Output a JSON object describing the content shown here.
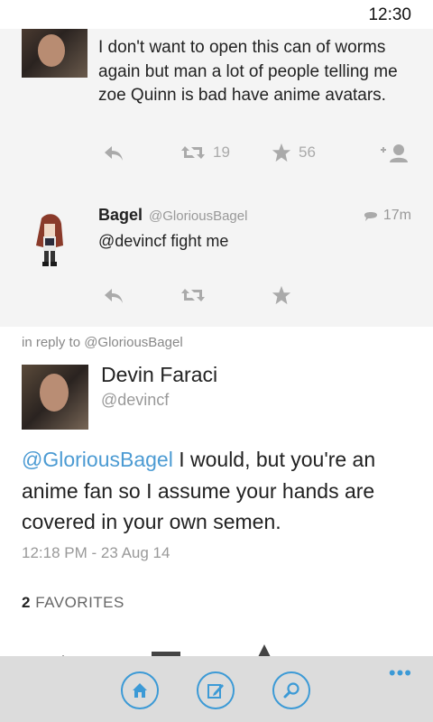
{
  "status": {
    "time": "12:30"
  },
  "thread": {
    "tweet1": {
      "text": "I don't want to open this can of worms again but man a lot of people telling me zoe Quinn is bad have anime avatars.",
      "retweets": "19",
      "favorites": "56"
    },
    "tweet2": {
      "name": "Bagel",
      "handle": "@GloriousBagel",
      "time": "17m",
      "text": "@devincf fight me"
    }
  },
  "main": {
    "reply_to": "in reply to @GloriousBagel",
    "name": "Devin Faraci",
    "handle": "@devincf",
    "mention": "@GloriousBagel",
    "text": " I would, but you're an anime fan so I assume your hands are covered in your own semen.",
    "date": "12:18 PM - 23 Aug 14",
    "favorites_count": "2",
    "favorites_label": "FAVORITES"
  },
  "appbar": {
    "more": "•••"
  },
  "colors": {
    "accent": "#3c9ad6",
    "mention": "#4c9bd3",
    "icon_gray": "#aaaaaa"
  },
  "icons": [
    "reply-icon",
    "retweet-icon",
    "star-icon",
    "follow-icon",
    "comment-icon",
    "home-icon",
    "compose-icon",
    "search-icon",
    "more-icon"
  ]
}
